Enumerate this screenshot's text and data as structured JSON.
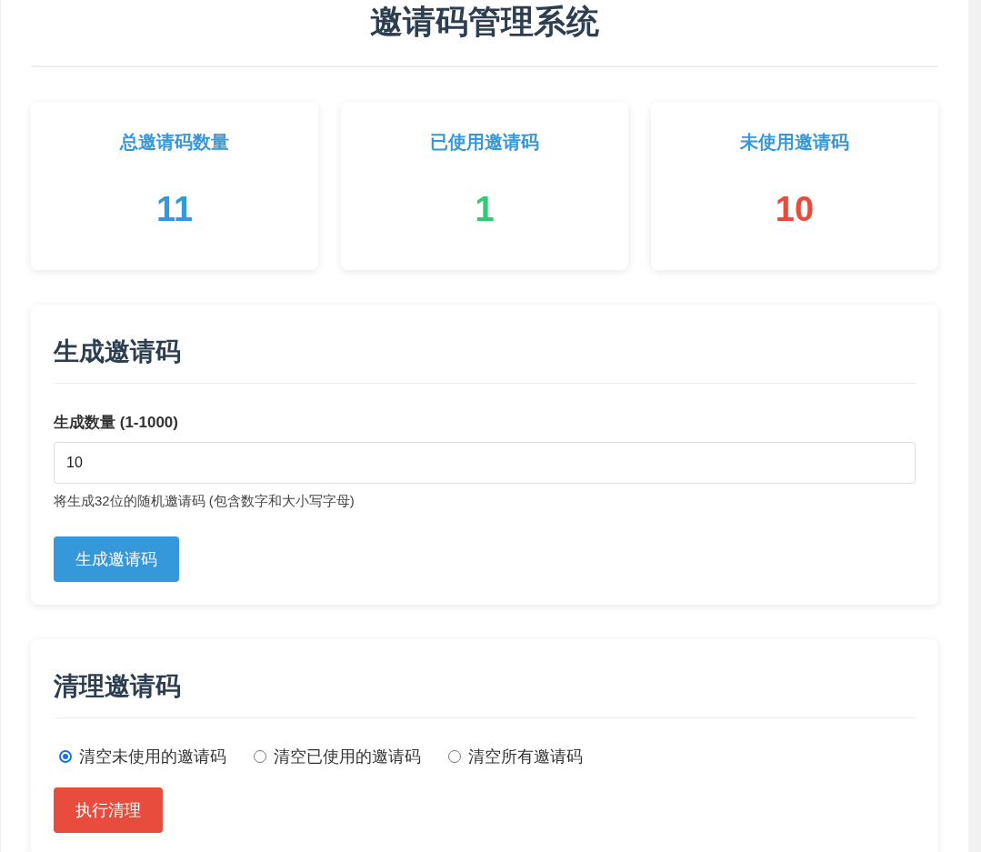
{
  "title": "邀请码管理系统",
  "stats": [
    {
      "label": "总邀请码数量",
      "value": "11",
      "color": "#3498db"
    },
    {
      "label": "已使用邀请码",
      "value": "1",
      "color": "#2ecc71"
    },
    {
      "label": "未使用邀请码",
      "value": "10",
      "color": "#e74c3c"
    }
  ],
  "generate": {
    "heading": "生成邀请码",
    "field_label": "生成数量 (1-1000)",
    "value": "10",
    "hint": "将生成32位的随机邀请码 (包含数字和大小写字母)",
    "button": "生成邀请码"
  },
  "cleanup": {
    "heading": "清理邀请码",
    "options": [
      {
        "label": "清空未使用的邀请码",
        "selected": true
      },
      {
        "label": "清空已使用的邀请码",
        "selected": false
      },
      {
        "label": "清空所有邀请码",
        "selected": false
      }
    ],
    "button": "执行清理"
  }
}
